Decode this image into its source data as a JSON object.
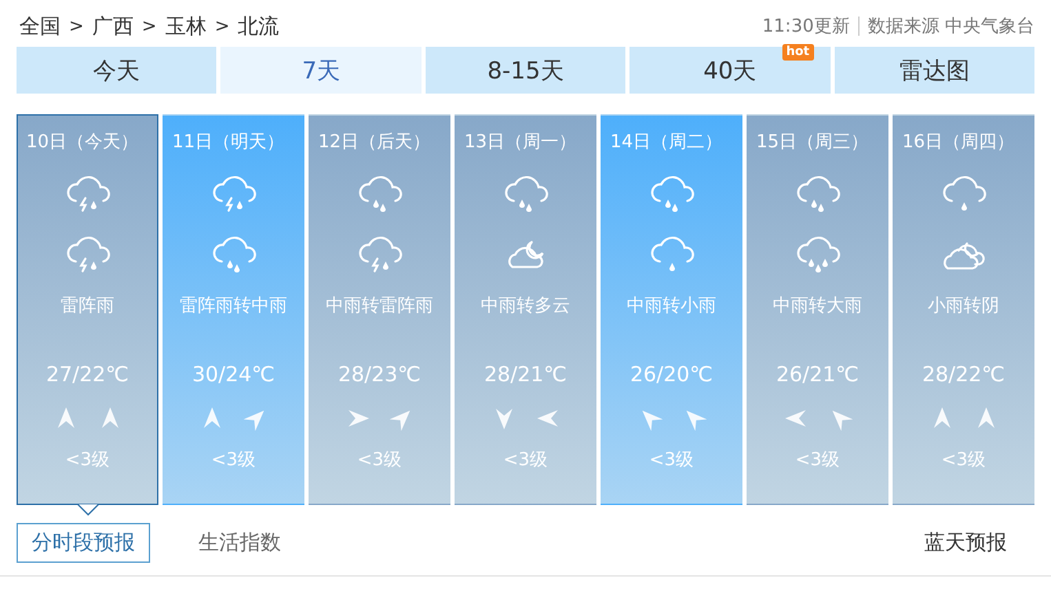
{
  "breadcrumb": [
    {
      "label": "全国"
    },
    {
      "label": "广西"
    },
    {
      "label": "玉林"
    },
    {
      "label": "北流"
    }
  ],
  "breadcrumb_separator": ">",
  "update_time": "11:30更新",
  "source": "数据来源 中央气象台",
  "tabs": [
    {
      "label": "今天",
      "selected": false
    },
    {
      "label": "7天",
      "selected": true
    },
    {
      "label": "8-15天",
      "selected": false
    },
    {
      "label": "40天",
      "selected": false,
      "badge": "hot"
    },
    {
      "label": "雷达图",
      "selected": false
    }
  ],
  "days": [
    {
      "date": "10日（今天）",
      "selected": true,
      "highlight": false,
      "icons": [
        {
          "kind": "thunder"
        },
        {
          "kind": "thunder"
        }
      ],
      "weather": "雷阵雨",
      "temp": "27/22℃",
      "winds": [
        {
          "kind": "up"
        },
        {
          "kind": "up"
        }
      ],
      "level": "<3级"
    },
    {
      "date": "11日（明天）",
      "selected": false,
      "highlight": true,
      "icons": [
        {
          "kind": "thunder"
        },
        {
          "kind": "rain"
        }
      ],
      "weather": "雷阵雨转中雨",
      "temp": "30/24℃",
      "winds": [
        {
          "kind": "up"
        },
        {
          "kind": "upright"
        }
      ],
      "level": "<3级"
    },
    {
      "date": "12日（后天）",
      "selected": false,
      "highlight": false,
      "icons": [
        {
          "kind": "rain"
        },
        {
          "kind": "thunder"
        }
      ],
      "weather": "中雨转雷阵雨",
      "temp": "28/23℃",
      "winds": [
        {
          "kind": "right"
        },
        {
          "kind": "upright"
        }
      ],
      "level": "<3级"
    },
    {
      "date": "13日（周一）",
      "selected": false,
      "highlight": false,
      "icons": [
        {
          "kind": "rain"
        },
        {
          "kind": "mooncloud"
        }
      ],
      "weather": "中雨转多云",
      "temp": "28/21℃",
      "winds": [
        {
          "kind": "down"
        },
        {
          "kind": "left"
        }
      ],
      "level": "<3级"
    },
    {
      "date": "14日（周二）",
      "selected": false,
      "highlight": true,
      "icons": [
        {
          "kind": "rain"
        },
        {
          "kind": "drizzle"
        }
      ],
      "weather": "中雨转小雨",
      "temp": "26/20℃",
      "winds": [
        {
          "kind": "upleft"
        },
        {
          "kind": "upleft"
        }
      ],
      "level": "<3级"
    },
    {
      "date": "15日（周三）",
      "selected": false,
      "highlight": false,
      "icons": [
        {
          "kind": "rain"
        },
        {
          "kind": "heavyrain"
        }
      ],
      "weather": "中雨转大雨",
      "temp": "26/21℃",
      "winds": [
        {
          "kind": "left"
        },
        {
          "kind": "upleft"
        }
      ],
      "level": "<3级"
    },
    {
      "date": "16日（周四）",
      "selected": false,
      "highlight": false,
      "icons": [
        {
          "kind": "drizzle"
        },
        {
          "kind": "overcast"
        }
      ],
      "weather": "小雨转阴",
      "temp": "28/22℃",
      "winds": [
        {
          "kind": "up"
        },
        {
          "kind": "up"
        }
      ],
      "level": "<3级"
    }
  ],
  "subtabs": [
    {
      "label": "分时段预报",
      "selected": true
    },
    {
      "label": "生活指数",
      "selected": false
    }
  ],
  "side_link": "蓝天预报"
}
